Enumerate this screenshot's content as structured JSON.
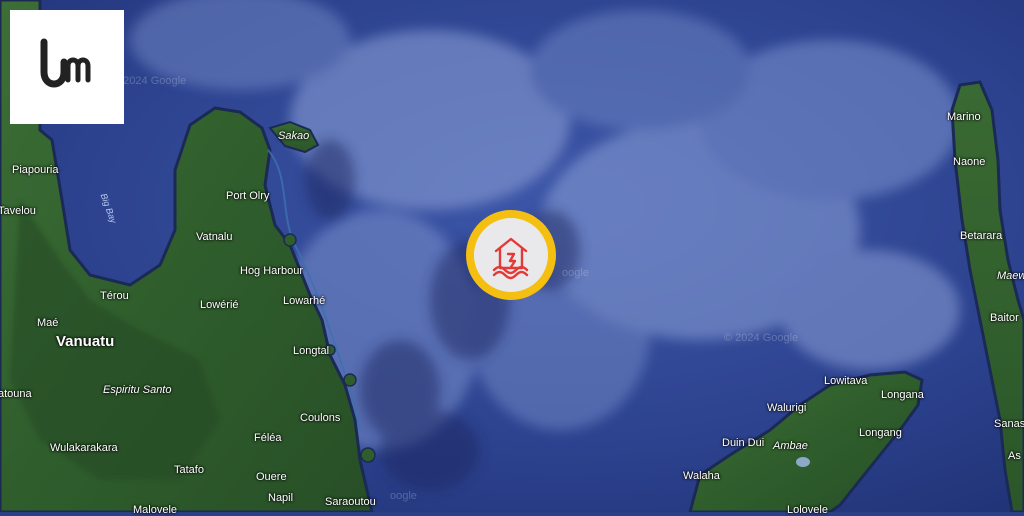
{
  "map": {
    "labels": {
      "piapouria": "Piapouria",
      "tavelou": "Tavelou",
      "big_bay": "Big Bay",
      "sakao": "Sakao",
      "port_olry": "Port Olry",
      "vatnalu": "Vatnalu",
      "hog_harbour": "Hog Harbour",
      "terou": "Térou",
      "lowerie": "Lowérié",
      "lowarhe": "Lowarhé",
      "mae": "Maé",
      "vanuatu": "Vanuatu",
      "longtal": "Longtal",
      "atouna": "atouna",
      "espiritu_santo": "Espiritu Santo",
      "coulons": "Coulons",
      "wulakarakara": "Wulakarakara",
      "felea": "Féléa",
      "tatafo": "Tatafo",
      "ouere": "Ouere",
      "napil": "Napil",
      "saraoutou": "Saraoutou",
      "malovele": "Malovele",
      "marino": "Marino",
      "naone": "Naone",
      "betarara": "Betarara",
      "maewo": "Maew",
      "baitora": "Baitor",
      "lowitava": "Lowitava",
      "walurigi": "Walurigi",
      "longana": "Longana",
      "longang": "Longang",
      "duin_dui": "Duin Dui",
      "ambae": "Ambae",
      "walaha": "Walaha",
      "sanas": "Sanas",
      "as": "As",
      "lolovele": "Lolovele"
    },
    "watermarks": {
      "wm1": "© 2024 Google",
      "wm2": "© 2024 Google",
      "wm3": "oogle",
      "wm4": "oogle"
    }
  },
  "marker": {
    "icon": "flood-house-icon",
    "ring_color": "#f5bf12",
    "icon_color": "#e53935"
  },
  "logo": {
    "icon": "um-logo"
  }
}
